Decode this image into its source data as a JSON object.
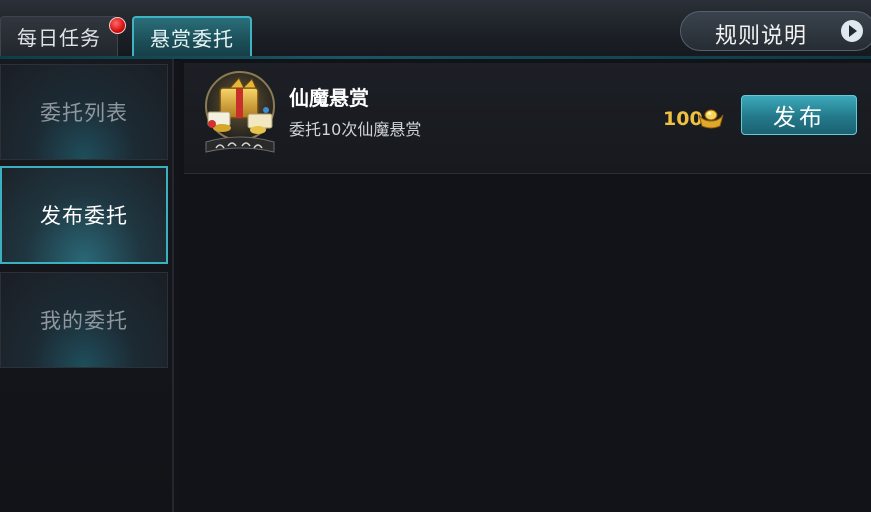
{
  "tabs": [
    {
      "label": "每日任务",
      "active": false,
      "has_notification": true
    },
    {
      "label": "悬赏委托",
      "active": true
    }
  ],
  "rules_button": {
    "label": "规则说明",
    "icon": "play-arrow-icon"
  },
  "sidebar": {
    "items": [
      {
        "label": "委托列表",
        "active": false
      },
      {
        "label": "发布委托",
        "active": true
      },
      {
        "label": "我的委托",
        "active": false
      }
    ]
  },
  "bounty": {
    "title": "仙魔悬赏",
    "description": "委托10次仙魔悬赏",
    "icon_caption": "仙魔悬赏",
    "cost": "100",
    "cost_icon": "gold-ingot-icon",
    "action_label": "发布"
  },
  "colors": {
    "accent": "#3cb0bf",
    "notification": "#d50f0f",
    "currency": "#f0c040"
  }
}
